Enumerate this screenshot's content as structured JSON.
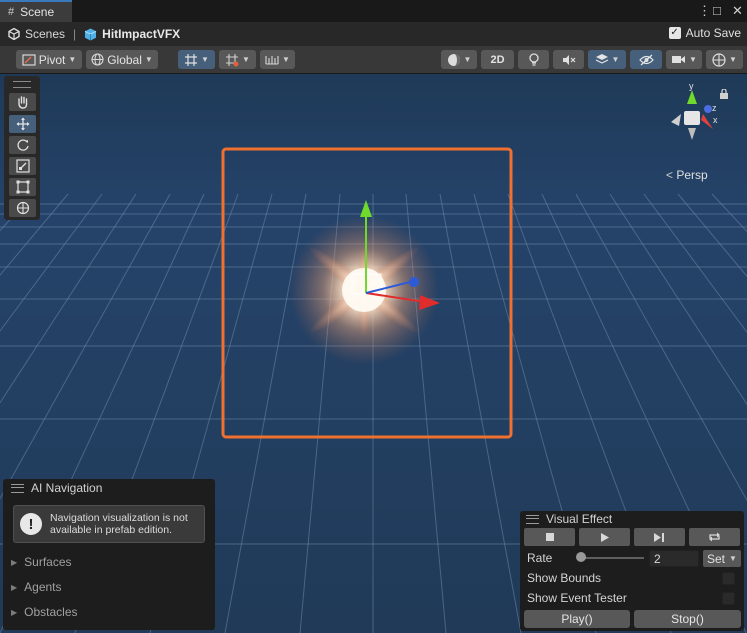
{
  "tab": {
    "icon": "grid-icon",
    "label": "Scene"
  },
  "window_controls": {
    "menu": "⋮",
    "maximize": "□",
    "close": "✕"
  },
  "breadcrumb": {
    "root": "Scenes",
    "separator": "|",
    "current": "HitImpactVFX"
  },
  "autosave": {
    "label": "Auto Save",
    "checked": true
  },
  "toolbar": {
    "pivot_label": "Pivot",
    "global_label": "Global",
    "mode_2d_label": "2D"
  },
  "tools": [
    "hand-icon",
    "move-icon",
    "rotate-icon",
    "scale-icon",
    "rect-tool-icon",
    "transform-icon"
  ],
  "gizmo": {
    "projection_label": "Persp",
    "axis_y": "y",
    "axis_z": "z",
    "axis_x": "x"
  },
  "ai_navigation": {
    "title": "AI Navigation",
    "help_message": "Navigation visualization is not available in prefab edition.",
    "foldouts": [
      "Surfaces",
      "Agents",
      "Obstacles"
    ]
  },
  "visual_effect": {
    "title": "Visual Effect",
    "rate_label": "Rate",
    "rate_value": "2",
    "rate_slider_fraction": 0.04,
    "set_label": "Set",
    "show_bounds_label": "Show Bounds",
    "show_event_tester_label": "Show Event Tester",
    "play_label": "Play()",
    "stop_label": "Stop()"
  },
  "colors": {
    "background": "#223c5a",
    "selection": "#f07030",
    "axis_x": "#e02c2c",
    "axis_y": "#6fd92c",
    "axis_z": "#2d5bd8",
    "accent": "#46607c"
  }
}
